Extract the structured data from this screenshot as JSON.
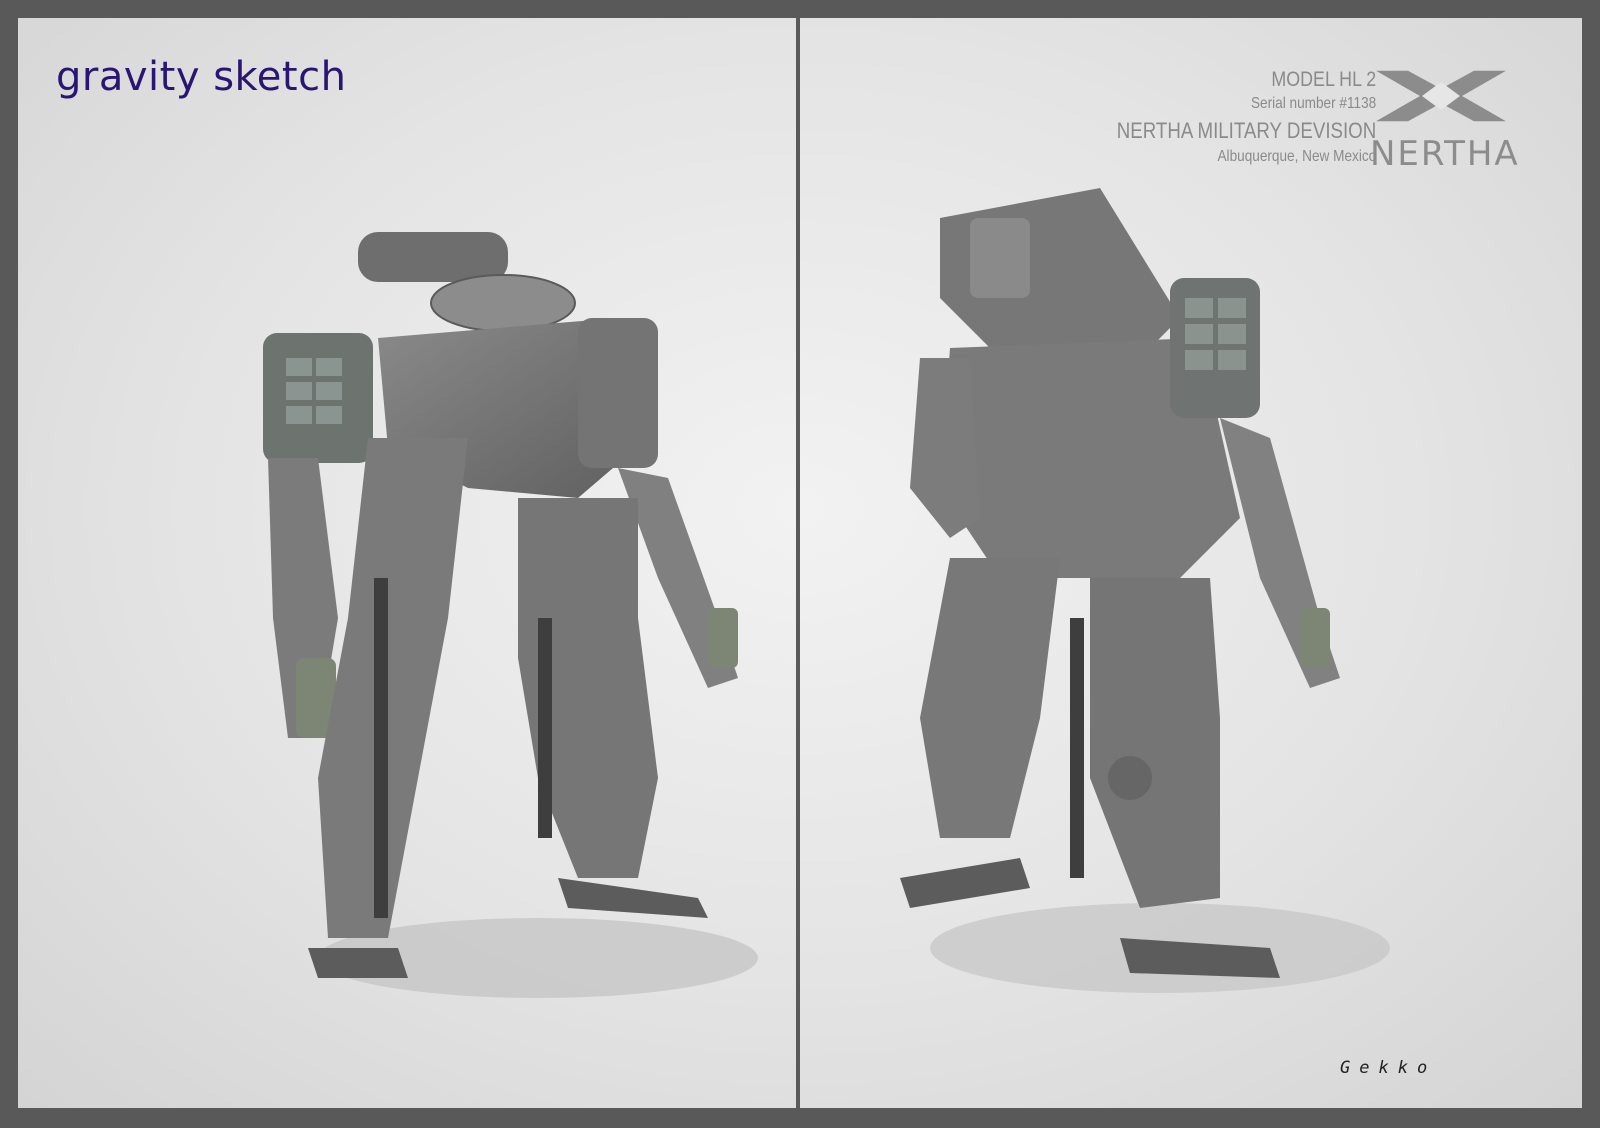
{
  "brand": {
    "title": "gravity sketch"
  },
  "model_info": {
    "model": "MODEL HL 2",
    "serial": "Serial number #1138",
    "division": "NERTHA MILITARY DEVISION",
    "location": "Albuquerque, New Mexico"
  },
  "logo": {
    "name": "NERTHA",
    "icon": "nertha-logo-icon"
  },
  "signature": "Gekko",
  "views": [
    {
      "name": "front-three-quarter-view",
      "icon": "mech-robot-render"
    },
    {
      "name": "rear-three-quarter-view",
      "icon": "mech-robot-render"
    }
  ],
  "colors": {
    "frame": "#595959",
    "background": "#e6e6e6",
    "brand_text": "#2a1672",
    "info_text": "#8a8a8a",
    "armor": "#7a7a7a",
    "armor_dark": "#4a4a4a",
    "hand": "#7d8574"
  }
}
